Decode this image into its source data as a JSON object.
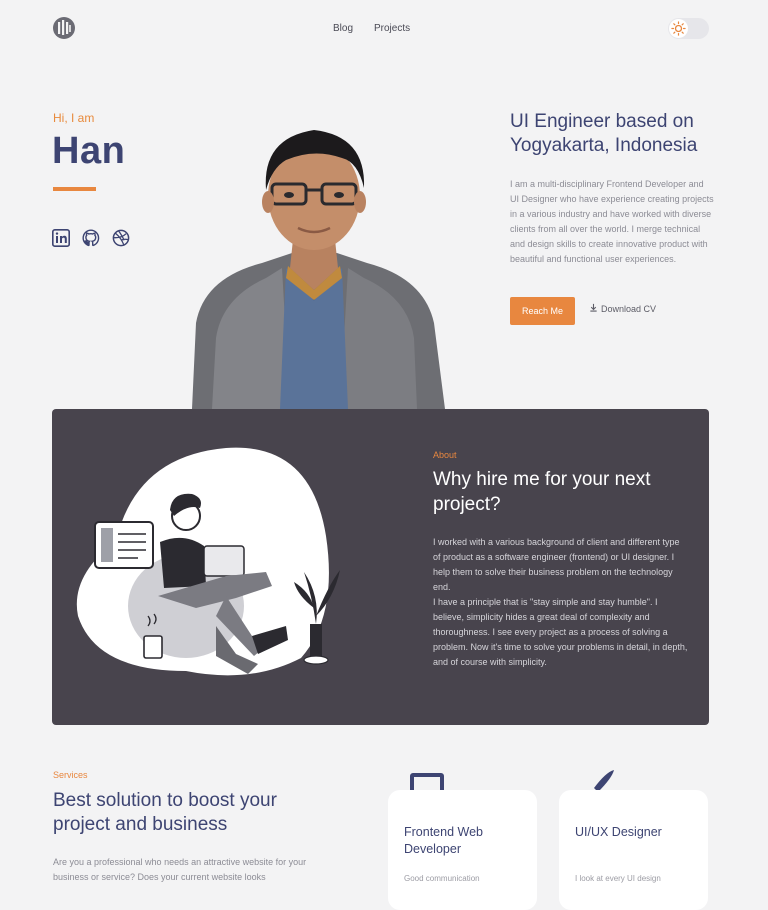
{
  "nav": {
    "links": [
      "Blog",
      "Projects"
    ],
    "theme_toggle": "sun-icon"
  },
  "hero": {
    "greeting": "Hi, I am",
    "name": "Han",
    "socials": [
      "linkedin-icon",
      "github-icon",
      "dribbble-icon"
    ],
    "headline": "UI Engineer based on Yogyakarta, Indonesia",
    "bio": "I am a multi-disciplinary Frontend Developer and UI Designer who have experience creating projects in a various industry and have worked with diverse clients from all over the world. I merge technical and design skills to create innovative product with beautiful and functional user experiences.",
    "cta_primary": "Reach Me",
    "cta_secondary": "Download CV"
  },
  "about": {
    "label": "About",
    "title": "Why hire me for your next project?",
    "paragraphs": [
      "I worked with a various background of client and different type of product as a software engineer (frontend) or UI designer. I help them to solve their business problem on the technology end.",
      "I have a principle that is \"stay simple and stay humble\". I believe, simplicity hides a great deal of complexity and thoroughness. I see every project as a process of solving a problem. Now it's time to solve your problems in detail, in depth, and of course with simplicity."
    ]
  },
  "services": {
    "label": "Services",
    "title": "Best solution to boost your project and business",
    "body": "Are you a professional who needs an attractive website for your business or service? Does your current website looks",
    "cards": [
      {
        "title": "Frontend Web Developer",
        "text": "Good communication",
        "icon": "monitor-icon"
      },
      {
        "title": "UI/UX Designer",
        "text": "I look at every UI design",
        "icon": "paintbrush-icon"
      }
    ]
  },
  "colors": {
    "accent": "#e8873f",
    "navy": "#3d4472",
    "dark_panel": "#48444d"
  }
}
